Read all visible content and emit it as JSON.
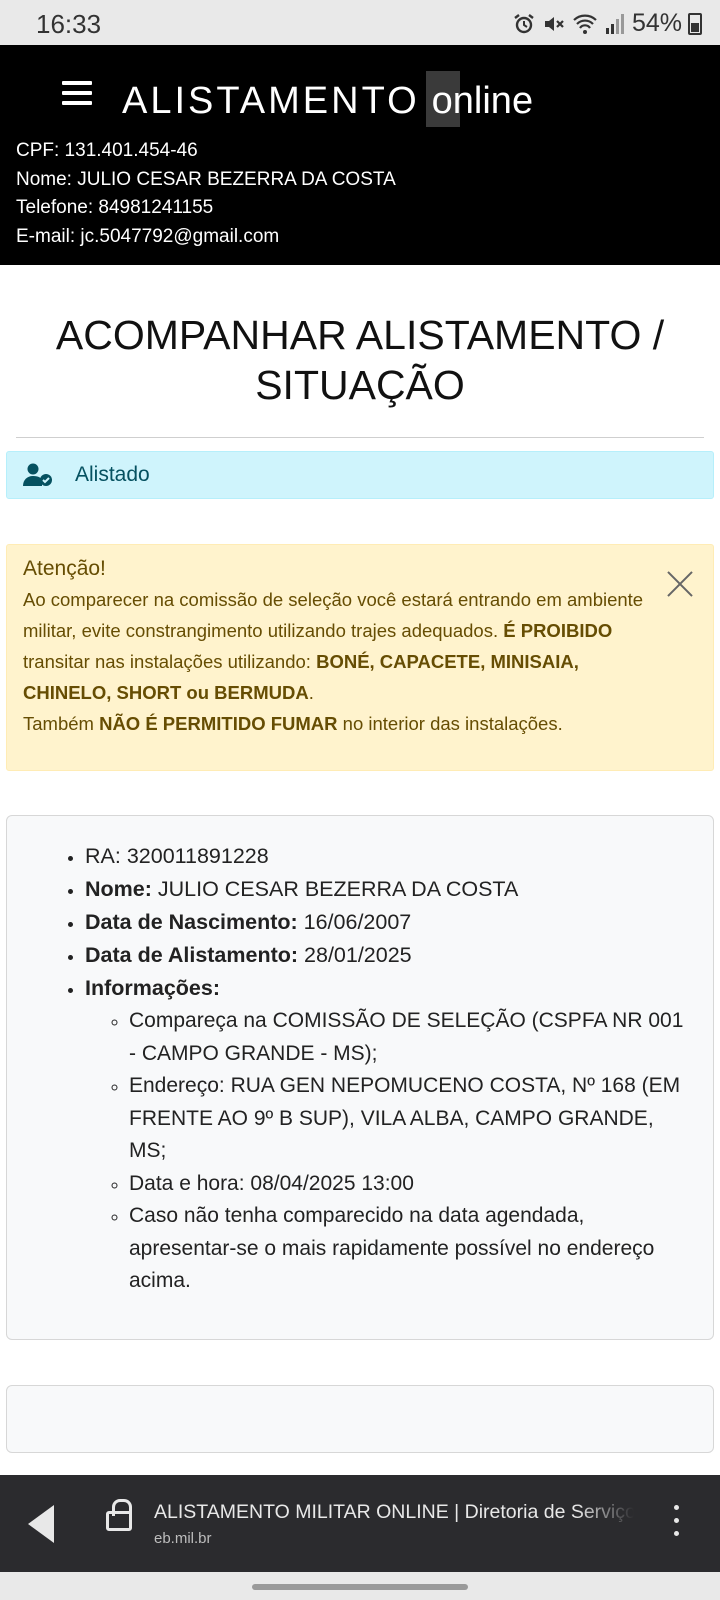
{
  "status_bar": {
    "time": "16:33",
    "battery": "54%",
    "icons": [
      "alarm-icon",
      "mute-icon",
      "wifi-icon",
      "signal-icon",
      "battery-icon"
    ]
  },
  "header": {
    "brand_main": "ALISTAMENTO",
    "brand_suffix": "online",
    "user": {
      "cpf": "CPF: 131.401.454-46",
      "nome": "Nome: JULIO CESAR BEZERRA DA COSTA",
      "telefone": "Telefone: 84981241155",
      "email": "E-mail: jc.5047792@gmail.com"
    }
  },
  "page": {
    "title_line1": "ACOMPANHAR ALISTAMENTO /",
    "title_line2": "SITUAÇÃO"
  },
  "status_alert": {
    "label": "Alistado",
    "icon": "user-check-icon",
    "color": "#055160",
    "background": "#cff4fc"
  },
  "warning": {
    "title": "Atenção!",
    "t1": "Ao comparecer na comissão de seleção você estará entrando em ambiente militar, evite constrangimento utilizando trajes adequados. ",
    "b1": "É PROIBIDO",
    "t2": " transitar nas instalações utilizando: ",
    "b2": "BONÉ, CAPACETE, MINISAIA, CHINELO, SHORT ou BERMUDA",
    "t3": ".",
    "t4": "Também ",
    "b3": "NÃO É PERMITIDO FUMAR",
    "t5": " no interior das instalações.",
    "background": "#fff3cd",
    "color": "#664d03"
  },
  "details": {
    "ra_label": "RA:",
    "ra_value": " 320011891228",
    "nome_label": "Nome:",
    "nome_value": " JULIO CESAR BEZERRA DA COSTA",
    "nasc_label": "Data de Nascimento:",
    "nasc_value": " 16/06/2007",
    "alist_label": "Data de Alistamento:",
    "alist_value": " 28/01/2025",
    "info_label": "Informações:",
    "info_items": [
      "Compareça na COMISSÃO DE SELEÇÃO (CSPFA NR 001 - CAMPO GRANDE - MS);",
      "Endereço: RUA GEN NEPOMUCENO COSTA, Nº 168 (EM FRENTE AO 9º B SUP), VILA ALBA, CAMPO GRANDE, MS;",
      "Data e hora: 08/04/2025 13:00",
      "Caso não tenha comparecido na data agendada, apresentar-se o mais rapidamente possível no endereço acima."
    ]
  },
  "browser": {
    "page_title": "ALISTAMENTO MILITAR ONLINE | Diretoria de Serviço Militar",
    "domain": "eb.mil.br"
  }
}
